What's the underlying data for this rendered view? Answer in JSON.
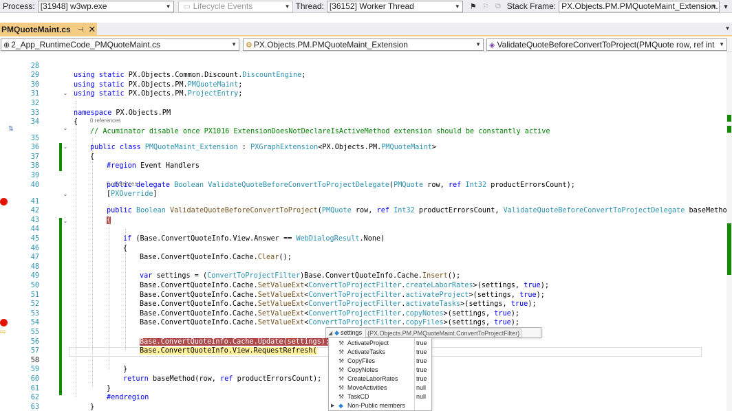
{
  "toolbar": {
    "process_label": "Process:",
    "process_value": "[31948] w3wp.exe",
    "lifecycle_label": "Lifecycle Events",
    "thread_label": "Thread:",
    "thread_value": "[36152] Worker Thread",
    "stackframe_label": "Stack Frame:",
    "stackframe_value": "PX.Objects.PM.PMQuoteMaint_Extension."
  },
  "tab": {
    "title": "PMQuoteMaint.cs",
    "pin_icon": "pin-icon",
    "close_icon": "close-icon"
  },
  "navbar": {
    "project": "2_App_RuntimeCode_PMQuoteMaint.cs",
    "class": "PX.Objects.PM.PMQuoteMaint_Extension",
    "member": "ValidateQuoteBeforeConvertToProject(PMQuote row, ref int"
  },
  "editor": {
    "references_class": "0 references",
    "references_method": "0 references",
    "lines": {
      "l28": {
        "num": "28",
        "a": "using static ",
        "b": "PX.Objects.Common.Discount.",
        "c": "DiscountEngine",
        "d": ";"
      },
      "l29": {
        "num": "29",
        "a": "using static ",
        "b": "PX.Objects.PM.",
        "c": "PMQuoteMaint",
        "d": ";"
      },
      "l30": {
        "num": "30",
        "a": "using static ",
        "b": "PX.Objects.PM.",
        "c": "ProjectEntry",
        "d": ";"
      },
      "l31": {
        "num": "31"
      },
      "l32": {
        "num": "32",
        "a": "namespace ",
        "b": "PX.Objects.PM"
      },
      "l33": {
        "num": "33",
        "b": "{"
      },
      "l34": {
        "num": "34",
        "c": "// Acuminator disable once PX1016 ExtensionDoesNotDeclareIsActiveMethod extension should be constantly active"
      },
      "l35": {
        "num": "35",
        "a": "public class ",
        "c": "PMQuoteMaint_Extension",
        "b": " : ",
        "d": "PXGraphExtension",
        "e": "<PX.Objects.PM.",
        "f": "PMQuoteMaint",
        "g": ">"
      },
      "l36": {
        "num": "36",
        "b": "{"
      },
      "l37": {
        "num": "37",
        "a": "#region ",
        "b": "Event Handlers"
      },
      "l38": {
        "num": "38"
      },
      "l39": {
        "num": "39",
        "a": "public delegate ",
        "c": "Boolean ",
        "f": "ValidateQuoteBeforeConvertToProjectDelegate",
        "b": "(",
        "d": "PMQuote",
        "e": " row, ",
        "g": "ref ",
        "h": "Int32",
        "i": " productErrorsCount);"
      },
      "l40": {
        "num": "40",
        "b": "[",
        "c": "PXOverride",
        "d": "]"
      },
      "l41": {
        "num": "41",
        "a": "public ",
        "c": "Boolean ",
        "f": "ValidateQuoteBeforeConvertToProject",
        "b": "(",
        "d": "PMQuote",
        "e": " row, ",
        "g": "ref ",
        "h": "Int32",
        "i": " productErrorsCount, ",
        "j": "ValidateQuoteBeforeConvertToProjectDelegate",
        "k": " baseMethod"
      },
      "l42": {
        "num": "42",
        "b": "{"
      },
      "l43": {
        "num": "43"
      },
      "l44": {
        "num": "44",
        "a": "if ",
        "b": "(Base.ConvertQuoteInfo.View.Answer == ",
        "c": "WebDialogResult",
        "d": ".None)"
      },
      "l45": {
        "num": "45",
        "b": "{"
      },
      "l46": {
        "num": "46",
        "b": "Base.ConvertQuoteInfo.Cache.",
        "f": "Clear",
        "d": "();"
      },
      "l47": {
        "num": "47"
      },
      "l48": {
        "num": "48",
        "a": "var ",
        "b": "settings = (",
        "c": "ConvertToProjectFilter",
        "d": ")Base.ConvertQuoteInfo.Cache.",
        "f": "Insert",
        "e": "();"
      },
      "l49": {
        "num": "49",
        "b": "Base.ConvertQuoteInfo.Cache.",
        "f": "SetValueExt",
        "d": "<",
        "c": "ConvertToProjectFilter",
        "e": ".",
        "g": "createLaborRates",
        "h": ">(settings, ",
        "a": "true",
        "i": ");"
      },
      "l50": {
        "num": "50",
        "b": "Base.ConvertQuoteInfo.Cache.",
        "f": "SetValueExt",
        "d": "<",
        "c": "ConvertToProjectFilter",
        "e": ".",
        "g": "activateProject",
        "h": ">(settings, ",
        "a": "true",
        "i": ");"
      },
      "l51": {
        "num": "51",
        "b": "Base.ConvertQuoteInfo.Cache.",
        "f": "SetValueExt",
        "d": "<",
        "c": "ConvertToProjectFilter",
        "e": ".",
        "g": "activateTasks",
        "h": ">(settings, ",
        "a": "true",
        "i": ");"
      },
      "l52": {
        "num": "52",
        "b": "Base.ConvertQuoteInfo.Cache.",
        "f": "SetValueExt",
        "d": "<",
        "c": "ConvertToProjectFilter",
        "e": ".",
        "g": "copyNotes",
        "h": ">(settings, ",
        "a": "true",
        "i": ");"
      },
      "l53": {
        "num": "53",
        "b": "Base.ConvertQuoteInfo.Cache.",
        "f": "SetValueExt",
        "d": "<",
        "c": "ConvertToProjectFilter",
        "e": ".",
        "g": "copyFiles",
        "h": ">(settings, ",
        "a": "true",
        "i": ");"
      },
      "l54": {
        "num": "54"
      },
      "l55": {
        "num": "55",
        "b": "Base.ConvertQuoteInfo.Cache.Update(settings);"
      },
      "l56": {
        "num": "56",
        "b": "Base.ConvertQuoteInfo.View.RequestRefresh("
      },
      "l57": {
        "num": "57"
      },
      "l58": {
        "num": "58",
        "b": "}"
      },
      "l59": {
        "num": "59",
        "a": "return ",
        "b": "baseMethod(row, ",
        "c": "ref ",
        "d": "productErrorsCount);"
      },
      "l60": {
        "num": "60",
        "b": "}"
      },
      "l61": {
        "num": "61",
        "a": "#endregion"
      },
      "l62": {
        "num": "62",
        "b": "}"
      },
      "l63": {
        "num": "63",
        "b": "}"
      }
    }
  },
  "datatip": {
    "name": "settings",
    "value": "{PX.Objects.PM.PMQuoteMaint.ConvertToProjectFilter}",
    "members": [
      {
        "name": "ActivateProject",
        "value": "true"
      },
      {
        "name": "ActivateTasks",
        "value": "true"
      },
      {
        "name": "CopyFiles",
        "value": "true"
      },
      {
        "name": "CopyNotes",
        "value": "true"
      },
      {
        "name": "CreateLaborRates",
        "value": "true"
      },
      {
        "name": "MoveActivities",
        "value": "null"
      },
      {
        "name": "TaskCD",
        "value": "null"
      },
      {
        "name": "Non-Public members",
        "value": ""
      }
    ]
  },
  "colors": {
    "keyword": "#0000ff",
    "type": "#2b91af",
    "comment": "#008000",
    "breakpoint": "#e51400",
    "current_statement": "#fff09a",
    "tab_active": "#f5cc84",
    "change_margin": "#108a00"
  }
}
